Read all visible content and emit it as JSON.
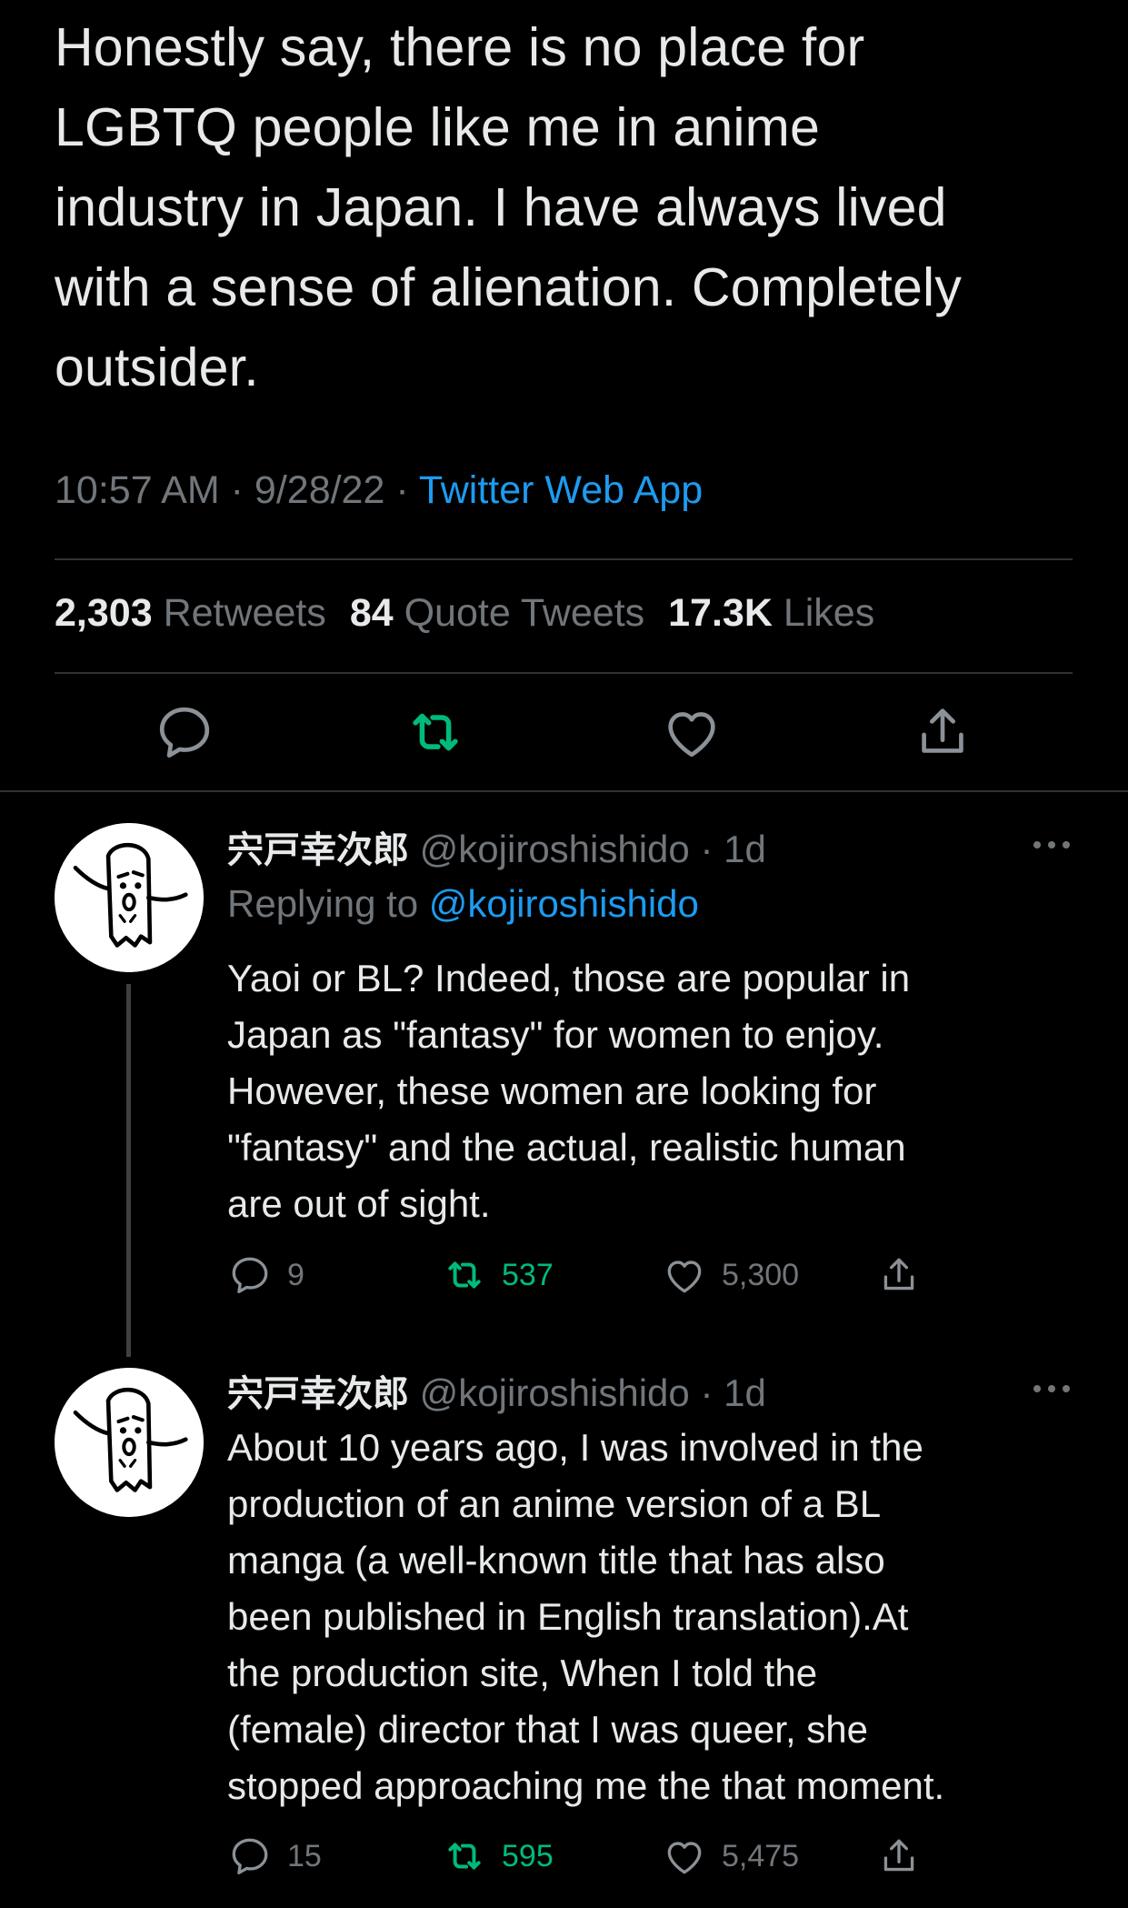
{
  "main_tweet": {
    "text_lines": [
      "Honestly say, there is no place for",
      "LGBTQ people like me in anime",
      "industry in Japan. I have always lived",
      "with a sense of alienation. Completely",
      "outsider."
    ],
    "time": "10:57 AM",
    "date": "9/28/22",
    "source": "Twitter Web App",
    "retweets_count": "2,303",
    "retweets_label": "Retweets",
    "quotes_count": "84",
    "quotes_label": "Quote Tweets",
    "likes_count": "17.3K",
    "likes_label": "Likes",
    "icons": [
      "reply-icon",
      "retweet-icon",
      "like-icon",
      "share-icon"
    ]
  },
  "replies": [
    {
      "display_name": "宍戸幸次郎",
      "handle": "@kojiroshishido",
      "age": "1d",
      "replying_to_label": "Replying to",
      "replying_to_handle": "@kojiroshishido",
      "text_lines": [
        "Yaoi or BL? Indeed, those are popular in",
        "Japan as \"fantasy\" for women to enjoy.",
        "However, these women are looking for",
        "\"fantasy\" and the actual, realistic human",
        "are out of sight."
      ],
      "reply_count": "9",
      "retweet_count": "537",
      "like_count": "5,300"
    },
    {
      "display_name": "宍戸幸次郎",
      "handle": "@kojiroshishido",
      "age": "1d",
      "text_lines": [
        "About 10 years ago, I was involved in the",
        "production of an anime version of a BL",
        "manga (a well-known title that has also",
        "been published in English translation).At",
        "the production site, When I told the",
        "(female) director that I was queer, she",
        "stopped approaching me the that moment."
      ],
      "reply_count": "15",
      "retweet_count": "595",
      "like_count": "5,475"
    }
  ],
  "colors": {
    "background": "#000000",
    "text": "#e7e9ea",
    "muted": "#71767b",
    "link": "#1d9bf0",
    "retweet_green": "#00ba7c",
    "divider": "#2f3336"
  }
}
